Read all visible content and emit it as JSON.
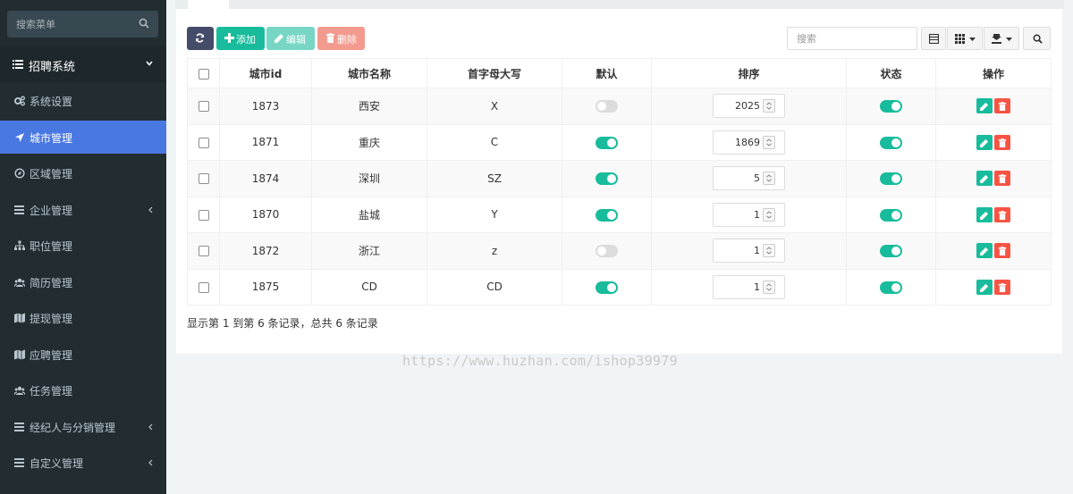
{
  "sidebar": {
    "search_placeholder": "搜索菜单",
    "group": "招聘系统",
    "items": [
      {
        "label": "系统设置",
        "icon": "gears-icon"
      },
      {
        "label": "城市管理",
        "icon": "location-arrow-icon",
        "active": true
      },
      {
        "label": "区域管理",
        "icon": "compass-icon"
      },
      {
        "label": "企业管理",
        "icon": "list-icon",
        "submenu": true
      },
      {
        "label": "职位管理",
        "icon": "sitemap-icon"
      },
      {
        "label": "简历管理",
        "icon": "users-icon"
      },
      {
        "label": "提现管理",
        "icon": "map-icon"
      },
      {
        "label": "应聘管理",
        "icon": "map-icon"
      },
      {
        "label": "任务管理",
        "icon": "users-icon"
      },
      {
        "label": "经纪人与分销管理",
        "icon": "list-icon",
        "submenu": true
      },
      {
        "label": "自定义管理",
        "icon": "list-icon",
        "submenu": true
      }
    ]
  },
  "toolbar": {
    "add_label": "添加",
    "edit_label": "编辑",
    "delete_label": "删除",
    "search_placeholder": "搜索"
  },
  "table": {
    "columns": [
      "",
      "城市id",
      "城市名称",
      "首字母大写",
      "默认",
      "排序",
      "状态",
      "操作"
    ],
    "rows": [
      {
        "id": "1873",
        "name": "西安",
        "initial": "X",
        "default": false,
        "sort": "2025",
        "status": true
      },
      {
        "id": "1871",
        "name": "重庆",
        "initial": "C",
        "default": true,
        "sort": "1869",
        "status": true
      },
      {
        "id": "1874",
        "name": "深圳",
        "initial": "SZ",
        "default": true,
        "sort": "5",
        "status": true
      },
      {
        "id": "1870",
        "name": "盐城",
        "initial": "Y",
        "default": true,
        "sort": "1",
        "status": true
      },
      {
        "id": "1872",
        "name": "浙江",
        "initial": "z",
        "default": false,
        "sort": "1",
        "status": true
      },
      {
        "id": "1875",
        "name": "CD",
        "initial": "CD",
        "default": true,
        "sort": "1",
        "status": true
      }
    ]
  },
  "footer": {
    "summary": "显示第 1 到第 6 条记录，总共 6 条记录"
  },
  "watermark": "https://www.huzhan.com/ishop39979",
  "colors": {
    "sidebar_bg": "#222d32",
    "active": "#4a78e2",
    "success": "#18bc9c",
    "danger": "#f75444",
    "dark": "#444c69"
  }
}
